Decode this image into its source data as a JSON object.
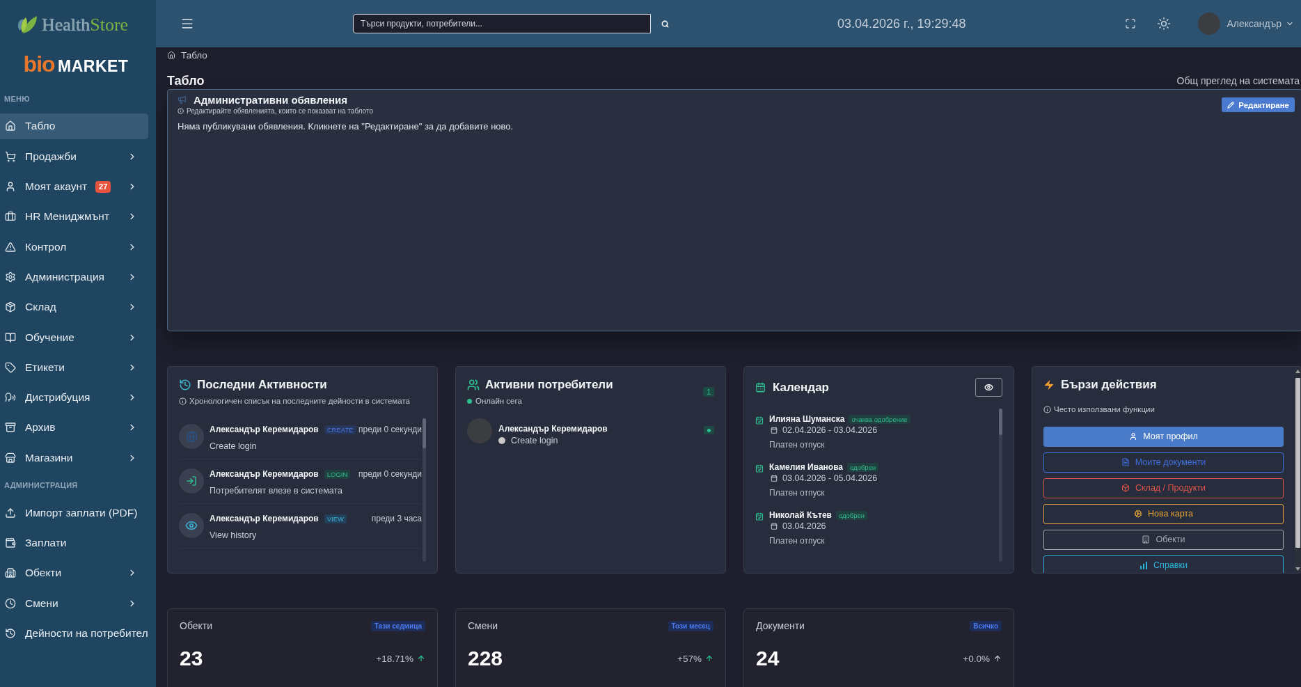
{
  "sidebar": {
    "brand": [
      "Health",
      "Store"
    ],
    "sub_brand": {
      "accent": "bio",
      "rest": "MARKET"
    },
    "sections": [
      {
        "title": "МЕНЮ",
        "items": [
          {
            "label": "Табло",
            "selected": true,
            "expandable": false
          },
          {
            "label": "Продажби",
            "selected": false,
            "expandable": true
          },
          {
            "label": "Моят акаунт",
            "selected": false,
            "expandable": true,
            "badge": "27"
          },
          {
            "label": "HR Мениджмънт",
            "selected": false,
            "expandable": true
          },
          {
            "label": "Контрол",
            "selected": false,
            "expandable": true
          },
          {
            "label": "Администрация",
            "selected": false,
            "expandable": true
          },
          {
            "label": "Склад",
            "selected": false,
            "expandable": true
          },
          {
            "label": "Обучение",
            "selected": false,
            "expandable": true
          },
          {
            "label": "Етикети",
            "selected": false,
            "expandable": true
          },
          {
            "label": "Дистрибуция",
            "selected": false,
            "expandable": true
          },
          {
            "label": "Архив",
            "selected": false,
            "expandable": true
          },
          {
            "label": "Магазини",
            "selected": false,
            "expandable": true
          }
        ]
      },
      {
        "title": "АДМИНИСТРАЦИЯ",
        "items": [
          {
            "label": "Импорт заплати (PDF)",
            "selected": false,
            "expandable": false
          },
          {
            "label": "Заплати",
            "selected": false,
            "expandable": false
          },
          {
            "label": "Обекти",
            "selected": false,
            "expandable": true
          },
          {
            "label": "Смени",
            "selected": false,
            "expandable": true
          },
          {
            "label": "Дейности на потребител",
            "selected": false,
            "expandable": false
          }
        ]
      }
    ]
  },
  "topbar": {
    "search": {
      "placeholder": "Търси продукти, потребители..."
    },
    "datetime": "03.04.2026 г., 19:29:48",
    "user": {
      "name": "Александър"
    }
  },
  "breadcrumb": [
    "Табло"
  ],
  "page": {
    "title": "Табло",
    "subtitle": "Общ преглед на системата"
  },
  "announcements": {
    "title": "Административни обявления",
    "hint": "Редактирайте обявленията, които се показват на таблото",
    "edit_button": "Редактиране",
    "empty_text": "Няма публикувани обявления. Кликнете на \"Редактиране\" за да добавите ново."
  },
  "activities": {
    "title": "Последни Активности",
    "hint": "Хронологичен списък на последните дейности в системата",
    "items": [
      {
        "kind": "create",
        "user": "Александър Керемидаров",
        "action": "CREATE",
        "time": "преди 0 секунди",
        "description": "Create login"
      },
      {
        "kind": "login",
        "user": "Александър Керемидаров",
        "action": "LOGIN",
        "time": "преди 0 секунди",
        "description": "Потребителят влезе в системата"
      },
      {
        "kind": "view",
        "user": "Александър Керемидаров",
        "action": "VIEW",
        "time": "преди 3 часа",
        "description": "View history"
      }
    ]
  },
  "active_users": {
    "title": "Активни потребители",
    "status": "Онлайн сега",
    "count": "1",
    "users": [
      {
        "name": "Александър Керемидаров",
        "activity": "Create login",
        "online": true
      }
    ]
  },
  "calendar": {
    "title": "Календар",
    "entries": [
      {
        "name": "Илияна Шуманска",
        "status": "очаква одобрение",
        "dates": "02.04.2026 - 03.04.2026",
        "type": "Платен отпуск"
      },
      {
        "name": "Камелия Иванова",
        "status": "одобрен",
        "dates": "03.04.2026 - 05.04.2026",
        "type": "Платен отпуск"
      },
      {
        "name": "Николай Кътев",
        "status": "одобрен",
        "dates": "03.04.2026",
        "type": "Платен отпуск"
      }
    ]
  },
  "quick_actions": {
    "title": "Бързи действия",
    "hint": "Често използвани функции",
    "buttons": [
      {
        "label": "Моят профил",
        "filled": true,
        "color": "#4a7bc9"
      },
      {
        "label": "Моите документи",
        "filled": false,
        "color": "#3d6fe0"
      },
      {
        "label": "Склад / Продукти",
        "filled": false,
        "color": "#e0534a"
      },
      {
        "label": "Нова карта",
        "filled": false,
        "color": "#e3a336"
      },
      {
        "label": "Обекти",
        "filled": false,
        "color": "#a4aab4"
      },
      {
        "label": "Справки",
        "filled": false,
        "color": "#2bb3dc"
      }
    ]
  },
  "stats": [
    {
      "title": "Обекти",
      "period": "Тази седмица",
      "value": "23",
      "change": "+18.71%",
      "positive": true
    },
    {
      "title": "Смени",
      "period": "Този месец",
      "value": "228",
      "change": "+57%",
      "positive": true
    },
    {
      "title": "Документи",
      "period": "Всичко",
      "value": "24",
      "change": "+0.0%",
      "positive": false
    }
  ]
}
